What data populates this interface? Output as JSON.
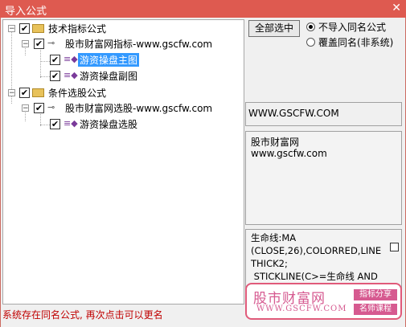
{
  "window": {
    "title": "导入公式",
    "close_glyph": "✕"
  },
  "tree": {
    "group1": {
      "label": "技术指标公式"
    },
    "sub1": {
      "label": "股市财富网指标-www.gscfw.com"
    },
    "item1": {
      "label": "游资操盘主图",
      "selected": true
    },
    "item2": {
      "label": "游资操盘副图"
    },
    "group2": {
      "label": "条件选股公式"
    },
    "sub2": {
      "label": "股市财富网选股-www.gscfw.com"
    },
    "item3": {
      "label": "游资操盘选股"
    },
    "check_glyph": "✔",
    "minus_glyph": "−"
  },
  "buttons": {
    "select_all": "全部选中"
  },
  "options": {
    "skip_same": "不导入同名公式",
    "overwrite_same": "覆盖同名(非系统)",
    "selected": "skip_same"
  },
  "info": {
    "url_box": "WWW.GSCFW.COM",
    "desc_line1": "股市财富网",
    "desc_line2": "www.gscfw.com",
    "code_text": "生命线:MA\n(CLOSE,26),COLORRED,LINE\nTHICK2;\n STICKLINE(C>=生命线 AND"
  },
  "status": "系统存在同名公式, 再次点击可以更名",
  "logo": {
    "name": "股市财富网",
    "url": "WWW.GSCFW.COM",
    "tag1": "指标分享",
    "tag2": "名师课程"
  }
}
